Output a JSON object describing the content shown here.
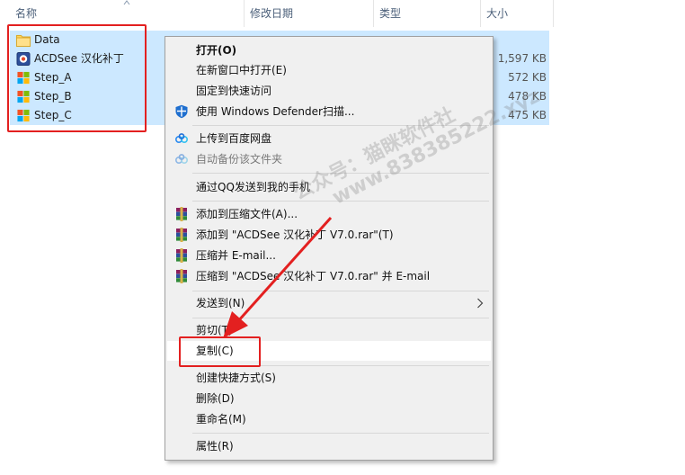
{
  "columns": {
    "name": "名称",
    "date": "修改日期",
    "type": "类型",
    "size": "大小"
  },
  "files": [
    {
      "name": "Data",
      "size": "",
      "icon": "folder-icon"
    },
    {
      "name": "ACDSee 汉化补丁",
      "size": "1,597 KB",
      "icon": "acdsee-app-icon"
    },
    {
      "name": "Step_A",
      "size": "572 KB",
      "icon": "windows-app-icon"
    },
    {
      "name": "Step_B",
      "size": "478 KB",
      "icon": "windows-app-icon"
    },
    {
      "name": "Step_C",
      "size": "475 KB",
      "icon": "windows-app-icon"
    }
  ],
  "menu": {
    "open": "打开(O)",
    "open_new_window": "在新窗口中打开(E)",
    "pin_quick_access": "固定到快速访问",
    "defender_scan": "使用 Windows Defender扫描...",
    "upload_baidu": "上传到百度网盘",
    "auto_backup": "自动备份该文件夹",
    "send_qq": "通过QQ发送到我的手机",
    "add_archive": "添加到压缩文件(A)...",
    "add_to_rar": "添加到 \"ACDSee 汉化补丁 V7.0.rar\"(T)",
    "compress_email": "压缩并 E-mail...",
    "compress_rar_email": "压缩到 \"ACDSee 汉化补丁 V7.0.rar\" 并 E-mail",
    "send_to": "发送到(N)",
    "cut": "剪切(T)",
    "copy": "复制(C)",
    "create_shortcut": "创建快捷方式(S)",
    "delete": "删除(D)",
    "rename": "重命名(M)",
    "properties": "属性(R)"
  },
  "watermark": {
    "line1": "公众号：猫眯软件社",
    "line2": "www.838385222.xyz"
  },
  "colors": {
    "selection": "#cce8ff",
    "annotation": "#e32020",
    "menu_bg": "#f0f0f0"
  }
}
